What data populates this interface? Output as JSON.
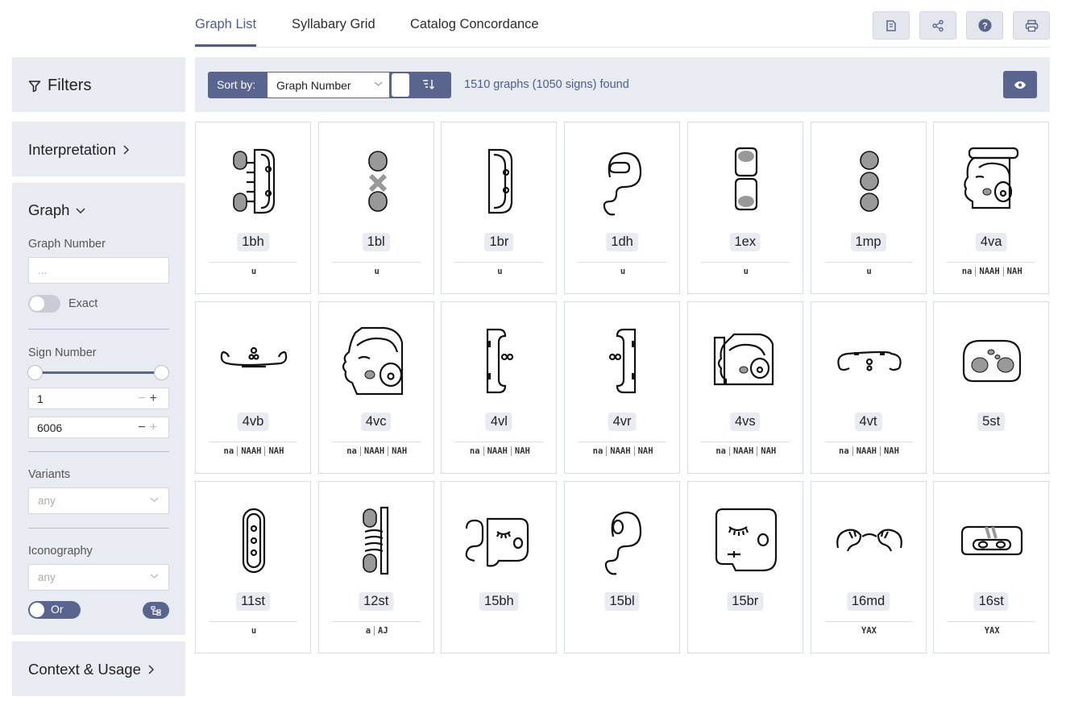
{
  "nav": {
    "tabs": [
      {
        "label": "Graph List",
        "active": true
      },
      {
        "label": "Syllabary Grid",
        "active": false
      },
      {
        "label": "Catalog Concordance",
        "active": false
      }
    ],
    "tools": [
      "catalog-icon",
      "share-icon",
      "help-icon",
      "print-icon"
    ]
  },
  "sidebar": {
    "filters_title": "Filters",
    "interpretation_title": "Interpretation",
    "graph_title": "Graph",
    "graph_number_label": "Graph Number",
    "graph_number_placeholder": "...",
    "exact_label": "Exact",
    "sign_number_label": "Sign Number",
    "sign_min": "1",
    "sign_max": "6006",
    "variants_label": "Variants",
    "variants_value": "any",
    "iconography_label": "Iconography",
    "iconography_value": "any",
    "or_label": "Or",
    "context_title": "Context & Usage"
  },
  "toolbar": {
    "sort_label": "Sort by:",
    "sort_value": "Graph Number",
    "result_count": "1510 graphs (1050 signs) found"
  },
  "cards": [
    {
      "code": "1bh",
      "readings": [
        "u"
      ]
    },
    {
      "code": "1bl",
      "readings": [
        "u"
      ]
    },
    {
      "code": "1br",
      "readings": [
        "u"
      ]
    },
    {
      "code": "1dh",
      "readings": [
        "u"
      ]
    },
    {
      "code": "1ex",
      "readings": [
        "u"
      ]
    },
    {
      "code": "1mp",
      "readings": [
        "u"
      ]
    },
    {
      "code": "4va",
      "readings": [
        "na",
        "NAAH",
        "NAH"
      ]
    },
    {
      "code": "4vb",
      "readings": [
        "na",
        "NAAH",
        "NAH"
      ]
    },
    {
      "code": "4vc",
      "readings": [
        "na",
        "NAAH",
        "NAH"
      ]
    },
    {
      "code": "4vl",
      "readings": [
        "na",
        "NAAH",
        "NAH"
      ]
    },
    {
      "code": "4vr",
      "readings": [
        "na",
        "NAAH",
        "NAH"
      ]
    },
    {
      "code": "4vs",
      "readings": [
        "na",
        "NAAH",
        "NAH"
      ]
    },
    {
      "code": "4vt",
      "readings": [
        "na",
        "NAAH",
        "NAH"
      ]
    },
    {
      "code": "5st",
      "readings": []
    },
    {
      "code": "11st",
      "readings": [
        "u"
      ]
    },
    {
      "code": "12st",
      "readings": [
        "a",
        "AJ"
      ]
    },
    {
      "code": "15bh",
      "readings": []
    },
    {
      "code": "15bl",
      "readings": []
    },
    {
      "code": "15br",
      "readings": []
    },
    {
      "code": "16md",
      "readings": [
        "YAX"
      ]
    },
    {
      "code": "16st",
      "readings": [
        "YAX"
      ]
    }
  ]
}
